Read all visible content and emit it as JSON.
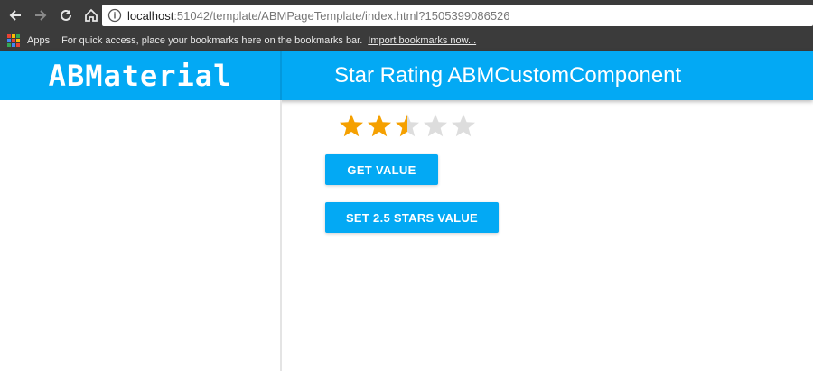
{
  "browser": {
    "url_host": "localhost",
    "url_rest": ":51042/template/ABMPageTemplate/index.html?1505399086526",
    "bookmarks": {
      "apps_label": "Apps",
      "hint": "For quick access, place your bookmarks here on the bookmarks bar.",
      "import_link": "Import bookmarks now..."
    }
  },
  "header": {
    "logo": "ABMaterial",
    "title": "Star Rating ABMCustomComponent"
  },
  "rating": {
    "max_stars": 5,
    "value": 2.5,
    "filled_color": "#f5a000",
    "empty_color": "#dddddd"
  },
  "buttons": {
    "get_value": "GET VALUE",
    "set_value": "SET 2.5 STARS VALUE"
  },
  "colors": {
    "primary": "#03a9f4",
    "chrome": "#3b3b3b"
  }
}
